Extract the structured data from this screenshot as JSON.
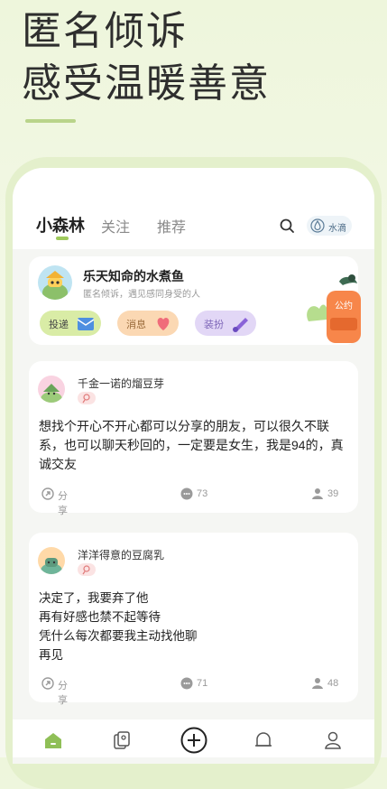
{
  "hero": {
    "line1": "匿名倾诉",
    "line2": "感受温暖善意"
  },
  "tabs": [
    {
      "label": "小森林",
      "active": true
    },
    {
      "label": "关注",
      "active": false
    },
    {
      "label": "推荐",
      "active": false
    }
  ],
  "header": {
    "water_label": "水滴",
    "water_icon": "water-drop-icon",
    "search_icon": "search-icon"
  },
  "profile": {
    "name": "乐天知命的水煮鱼",
    "subtitle": "匿名倾诉，遇见感同身受的人",
    "actions": [
      {
        "label": "投递",
        "icon": "mail-icon",
        "color": "#d9eca6"
      },
      {
        "label": "消息",
        "icon": "heart-message-icon",
        "color": "#fbd8b3"
      },
      {
        "label": "装扮",
        "icon": "brush-icon",
        "color": "#e2d7f6"
      }
    ],
    "mailbox_label": "公约"
  },
  "posts": [
    {
      "author": "千金一诺的熘豆芽",
      "content": "想找个开心不开心都可以分享的朋友，可以很久不联系，也可以聊天秒回的，一定要是女生，我是94的，真诚交友",
      "share_label": "分享",
      "comments": "73",
      "likes": "39"
    },
    {
      "author": "洋洋得意的豆腐乳",
      "content_lines": [
        "决定了，我要弃了他",
        "再有好感也禁不起等待",
        "凭什么每次都要我主动找他聊",
        "再见"
      ],
      "share_label": "分享",
      "comments": "71",
      "likes": "48"
    }
  ],
  "bottom_nav": [
    "home-icon",
    "cards-icon",
    "add-icon",
    "bell-icon",
    "profile-icon"
  ],
  "colors": {
    "accent": "#9fca5c",
    "background": "#eef6dc"
  }
}
